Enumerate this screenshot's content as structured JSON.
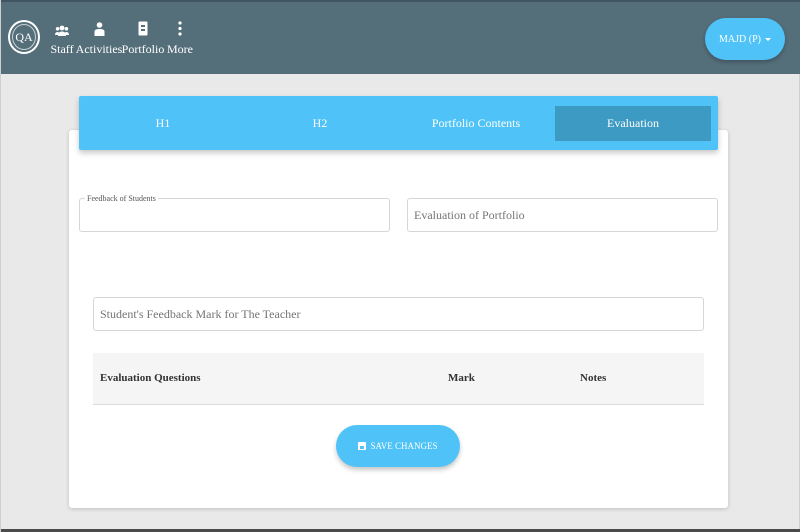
{
  "navbar": {
    "logo_text": "QA",
    "items": [
      {
        "label": "Staff",
        "icon": "users-icon"
      },
      {
        "label": "Activities",
        "icon": "person-icon"
      },
      {
        "label": "Portfolio",
        "icon": "portfolio-icon"
      },
      {
        "label": "More",
        "icon": "more-vertical-icon"
      }
    ],
    "user_label": "MAJD (P)"
  },
  "tabs": [
    {
      "label": "H1",
      "active": false
    },
    {
      "label": "H2",
      "active": false
    },
    {
      "label": "Portfolio Contents",
      "active": false
    },
    {
      "label": "Evaluation",
      "active": true
    }
  ],
  "form": {
    "feedback_legend": "Feedback of Students",
    "feedback_value": "",
    "evaluation_placeholder": "Evaluation of Portfolio",
    "student_feedback_placeholder": "Student's Feedback Mark for The Teacher"
  },
  "table": {
    "headers": [
      "Evaluation Questions",
      "Mark",
      "Notes"
    ]
  },
  "save_button": {
    "label": "SAVE CHANGES",
    "icon": "save-icon"
  },
  "colors": {
    "navbar": "#546e7a",
    "accent": "#4fc3f7",
    "active_tab": "#3d9ac3"
  }
}
